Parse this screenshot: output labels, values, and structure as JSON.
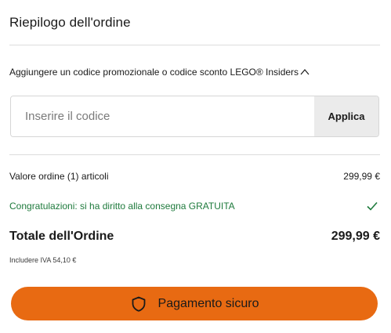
{
  "summary": {
    "title": "Riepilogo dell'ordine"
  },
  "promo": {
    "toggle_label": "Aggiungere un codice promozionale o codice sconto LEGO® Insiders",
    "input_placeholder": "Inserire il codice",
    "input_value": "",
    "apply_label": "Applica"
  },
  "order": {
    "value_label": "Valore ordine (1) articoli",
    "value_amount": "299,99 €",
    "delivery_message": "Congratulazioni: si ha diritto alla consegna GRATUITA",
    "total_label": "Totale dell'Ordine",
    "total_amount": "299,99 €",
    "vat_note": "Includere IVA 54,10 €"
  },
  "checkout": {
    "button_label": "Pagamento sicuro"
  },
  "icons": {
    "caret": "chevron-up-icon",
    "check": "check-icon",
    "shield": "shield-icon"
  },
  "colors": {
    "accent": "#e86a12",
    "success": "#1e7a3c",
    "apply_bg": "#ebebeb"
  }
}
